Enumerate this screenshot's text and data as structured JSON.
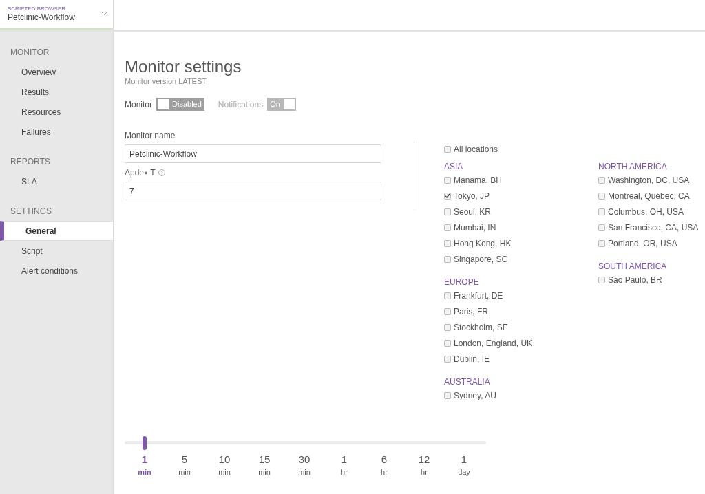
{
  "product_selector": {
    "kind_label": "SCRIPTED BROWSER",
    "name": "Petclinic-Workflow"
  },
  "sidebar": {
    "sections": [
      {
        "title": "MONITOR",
        "items": [
          {
            "label": "Overview",
            "selected": false
          },
          {
            "label": "Results",
            "selected": false
          },
          {
            "label": "Resources",
            "selected": false
          },
          {
            "label": "Failures",
            "selected": false
          }
        ]
      },
      {
        "title": "REPORTS",
        "items": [
          {
            "label": "SLA",
            "selected": false
          }
        ]
      },
      {
        "title": "SETTINGS",
        "items": [
          {
            "label": "General",
            "selected": true
          },
          {
            "label": "Script",
            "selected": false
          },
          {
            "label": "Alert conditions",
            "selected": false
          }
        ]
      }
    ]
  },
  "page": {
    "title": "Monitor settings",
    "subtitle": "Monitor version LATEST"
  },
  "toggles": [
    {
      "label": "Monitor",
      "state_label": "Disabled",
      "on": false,
      "disabled": false
    },
    {
      "label": "Notifications",
      "state_label": "On",
      "on": true,
      "disabled": true
    }
  ],
  "fields": [
    {
      "label": "Monitor name",
      "value": "Petclinic-Workflow",
      "help": false
    },
    {
      "label": "Apdex T",
      "value": "7",
      "help": true
    }
  ],
  "all_locations": {
    "label": "All locations",
    "checked": false
  },
  "location_columns": [
    {
      "groups": [
        {
          "title": "ASIA",
          "locations": [
            {
              "label": "Manama, BH",
              "checked": false
            },
            {
              "label": "Tokyo, JP",
              "checked": true
            },
            {
              "label": "Seoul, KR",
              "checked": false
            },
            {
              "label": "Mumbai, IN",
              "checked": false
            },
            {
              "label": "Hong Kong, HK",
              "checked": false
            },
            {
              "label": "Singapore, SG",
              "checked": false
            }
          ]
        },
        {
          "title": "EUROPE",
          "locations": [
            {
              "label": "Frankfurt, DE",
              "checked": false
            },
            {
              "label": "Paris, FR",
              "checked": false
            },
            {
              "label": "Stockholm, SE",
              "checked": false
            },
            {
              "label": "London, England, UK",
              "checked": false
            },
            {
              "label": "Dublin, IE",
              "checked": false
            }
          ]
        },
        {
          "title": "AUSTRALIA",
          "locations": [
            {
              "label": "Sydney, AU",
              "checked": false
            }
          ]
        }
      ]
    },
    {
      "groups": [
        {
          "title": "NORTH AMERICA",
          "locations": [
            {
              "label": "Washington, DC, USA",
              "checked": false
            },
            {
              "label": "Montreal, Québec, CA",
              "checked": false
            },
            {
              "label": "Columbus, OH, USA",
              "checked": false
            },
            {
              "label": "San Francisco, CA, USA",
              "checked": false
            },
            {
              "label": "Portland, OR, USA",
              "checked": false
            }
          ]
        },
        {
          "title": "SOUTH AMERICA",
          "locations": [
            {
              "label": "São Paulo, BR",
              "checked": false
            }
          ]
        }
      ]
    }
  ],
  "frequency": [
    {
      "value": "1",
      "unit": "min",
      "selected": true
    },
    {
      "value": "5",
      "unit": "min",
      "selected": false
    },
    {
      "value": "10",
      "unit": "min",
      "selected": false
    },
    {
      "value": "15",
      "unit": "min",
      "selected": false
    },
    {
      "value": "30",
      "unit": "min",
      "selected": false
    },
    {
      "value": "1",
      "unit": "hr",
      "selected": false
    },
    {
      "value": "6",
      "unit": "hr",
      "selected": false
    },
    {
      "value": "12",
      "unit": "hr",
      "selected": false
    },
    {
      "value": "1",
      "unit": "day",
      "selected": false
    }
  ]
}
